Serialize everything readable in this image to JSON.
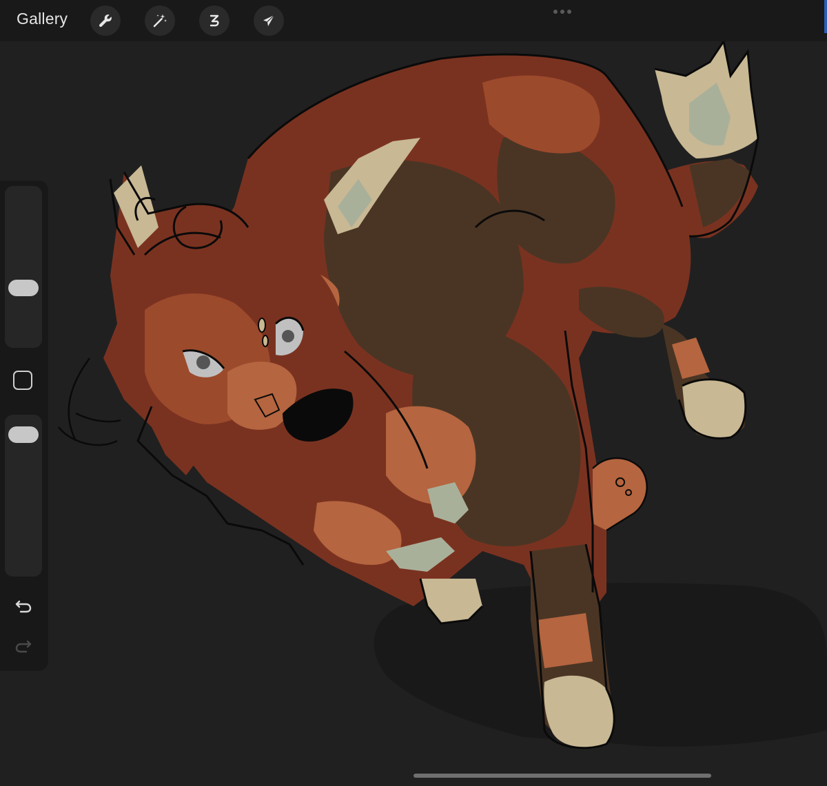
{
  "toolbar": {
    "gallery_label": "Gallery",
    "tools": [
      {
        "icon": "wrench-icon",
        "name": "actions"
      },
      {
        "icon": "magic-wand-icon",
        "name": "adjustments"
      },
      {
        "icon": "selection-s-icon",
        "name": "selection"
      },
      {
        "icon": "arrow-cursor-icon",
        "name": "transform"
      }
    ],
    "more_icon": "more-dots-icon"
  },
  "sidebar": {
    "brush_size_level": 0.35,
    "opacity_level": 0.94,
    "modify_icon": "square-icon",
    "undo_icon": "undo-icon",
    "redo_icon": "redo-icon"
  },
  "canvas": {
    "artwork": "cat-illustration",
    "background_color": "#202020"
  },
  "colors": {
    "fur_red": "#7a3220",
    "fur_orange": "#b5653f",
    "fur_dark": "#4a3524",
    "fur_cream": "#c8b894",
    "fur_sage": "#a9b09a",
    "line": "#0a0a0a"
  }
}
